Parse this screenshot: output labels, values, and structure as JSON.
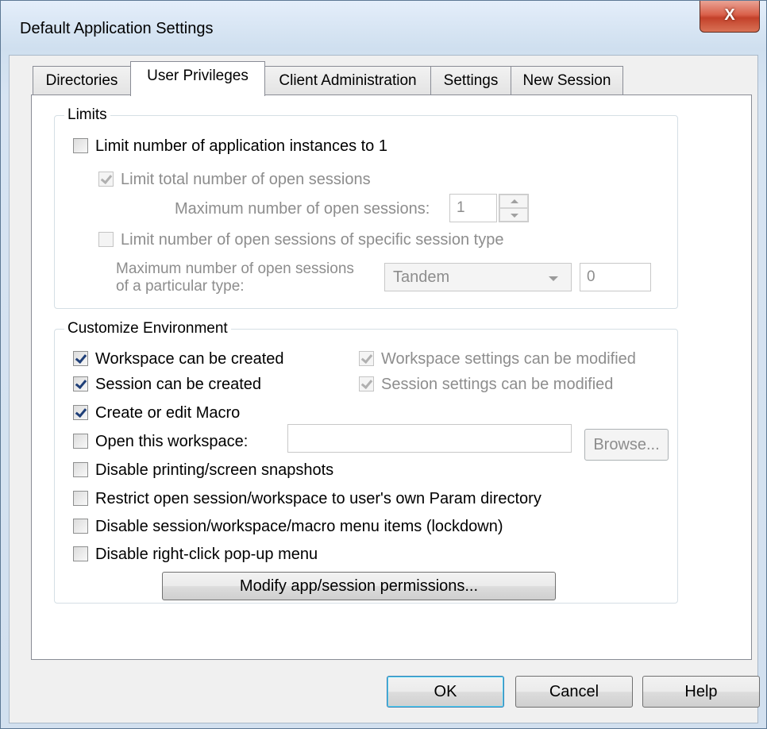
{
  "window": {
    "title": "Default Application Settings",
    "close_glyph": "X"
  },
  "tabs": [
    {
      "label": "Directories"
    },
    {
      "label": "User Privileges",
      "active": true
    },
    {
      "label": "Client Administration"
    },
    {
      "label": "Settings"
    },
    {
      "label": "New Session"
    }
  ],
  "limits": {
    "title": "Limits",
    "limit_instances": {
      "label": "Limit number of application instances to 1",
      "checked": false
    },
    "limit_total_sessions": {
      "label": "Limit total number of open sessions",
      "checked": true,
      "enabled": false
    },
    "max_open_sessions_label": "Maximum number of open sessions:",
    "max_open_sessions_value": "1",
    "limit_specific_type": {
      "label": "Limit number of open sessions of specific session type",
      "checked": false,
      "enabled": false
    },
    "max_particular_label_line1": "Maximum number of open sessions",
    "max_particular_label_line2": "of a particular type:",
    "session_type_selected": "Tandem",
    "particular_count_value": "0"
  },
  "customize": {
    "title": "Customize Environment",
    "workspace_created": {
      "label": "Workspace can be created",
      "checked": true
    },
    "workspace_modified": {
      "label": "Workspace settings can be modified",
      "checked": true,
      "enabled": false
    },
    "session_created": {
      "label": "Session can be created",
      "checked": true
    },
    "session_modified": {
      "label": "Session settings can be modified",
      "checked": true,
      "enabled": false
    },
    "macro": {
      "label": "Create or edit Macro",
      "checked": true
    },
    "open_workspace": {
      "label": "Open this workspace:",
      "checked": false,
      "value": ""
    },
    "browse_label": "Browse...",
    "disable_printing": {
      "label": "Disable printing/screen snapshots",
      "checked": false
    },
    "restrict_param": {
      "label": "Restrict open session/workspace to user's own Param directory",
      "checked": false
    },
    "disable_menu": {
      "label": "Disable session/workspace/macro menu items (lockdown)",
      "checked": false
    },
    "disable_rightclick": {
      "label": "Disable right-click pop-up menu",
      "checked": false
    },
    "modify_permissions_label": "Modify app/session permissions..."
  },
  "footer": {
    "ok_label": "OK",
    "cancel_label": "Cancel",
    "help_label": "Help"
  },
  "colors": {
    "check_mark": "#1f3f78",
    "disabled_text": "#8d8d8d",
    "close_button": "#c3412a"
  }
}
